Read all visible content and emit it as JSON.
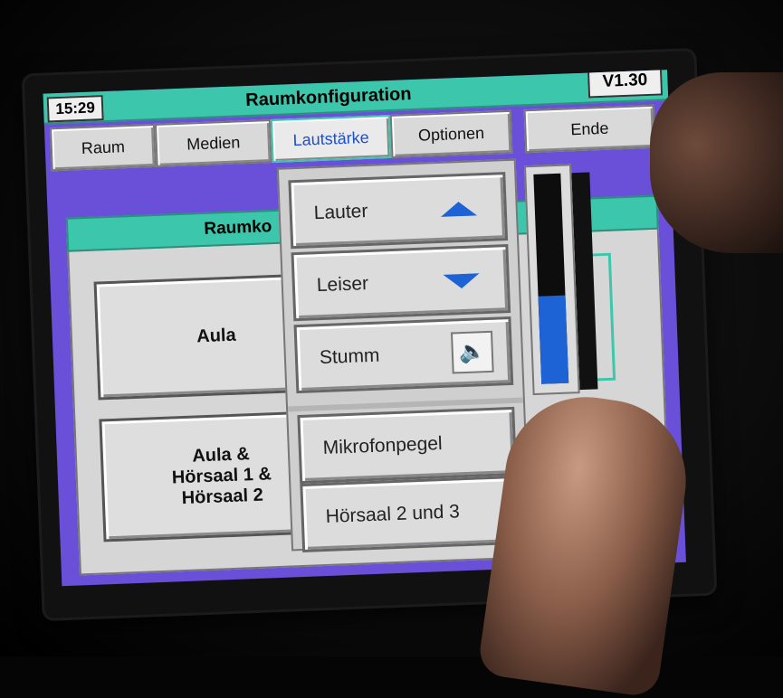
{
  "header": {
    "clock": "15:29",
    "title": "Raumkonfiguration",
    "version": "V1.30"
  },
  "tabs": [
    {
      "label": "Raum",
      "active": false
    },
    {
      "label": "Medien",
      "active": false
    },
    {
      "label": "Lautstärke",
      "active": true
    },
    {
      "label": "Optionen",
      "active": false
    },
    {
      "label": "Ende",
      "active": false
    }
  ],
  "content": {
    "title": "Raumko",
    "rooms": [
      {
        "label": "Aula"
      },
      {
        "label": "Aula &\nHörsaal 1 &\nHörsaal 2"
      }
    ]
  },
  "volume_menu": {
    "louder": "Lauter",
    "quieter": "Leiser",
    "mute": "Stumm",
    "microphone": "Mikrofonpegel",
    "hall": "Hörsaal 2 und 3"
  },
  "volume_level": 0.42,
  "icons": {
    "up": "arrow-up-icon",
    "down": "arrow-down-icon",
    "speaker": "speaker-icon"
  },
  "colors": {
    "titlebar": "#3cc6ac",
    "background": "#6a4fd8",
    "accent": "#1e63d6"
  }
}
